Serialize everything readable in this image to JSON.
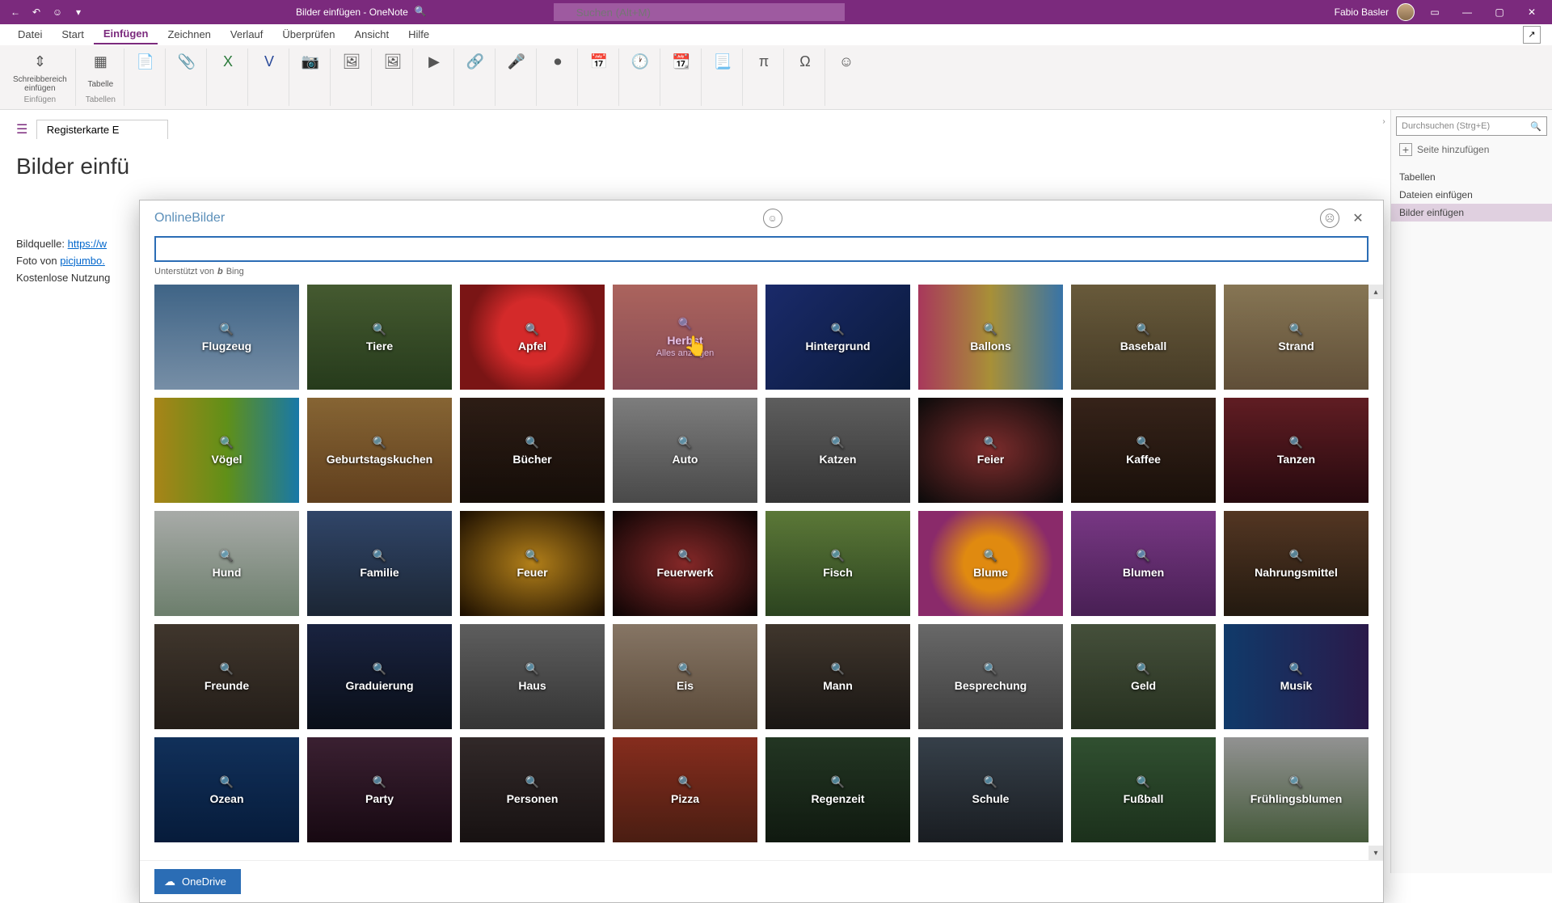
{
  "title_bar": {
    "app_title": "Bilder einfügen  -  OneNote",
    "search_placeholder": "Suchen (Alt+M)",
    "user_name": "Fabio Basler"
  },
  "ribbon_tabs": [
    "Datei",
    "Start",
    "Einfügen",
    "Zeichnen",
    "Verlauf",
    "Überprüfen",
    "Ansicht",
    "Hilfe"
  ],
  "ribbon_active": 2,
  "ribbon_groups": [
    {
      "label": "Schreibbereich\neinfügen",
      "sublabel": "Einfügen"
    },
    {
      "label": "Tabelle",
      "sublabel": "Tabellen"
    }
  ],
  "page": {
    "tab": "Registerkarte E",
    "title": "Bilder einfü",
    "src_label": "Bildquelle:",
    "src_link": "https://w",
    "photo_label": "Foto von",
    "photo_link": "picjumbo.",
    "license": "Kostenlose Nutzung"
  },
  "side": {
    "search_placeholder": "Durchsuchen (Strg+E)",
    "add_page": "Seite hinzufügen",
    "items": [
      "Tabellen",
      "Dateien einfügen",
      "Bilder einfügen"
    ],
    "active": 2
  },
  "dialog": {
    "title": "OnlineBilder",
    "powered_by": "Unterstützt von",
    "bing": "Bing",
    "onedrive": "OneDrive",
    "hover_sub": "Alles anzeigen",
    "categories": [
      {
        "label": "Flugzeug",
        "bg": "bg-plane"
      },
      {
        "label": "Tiere",
        "bg": "bg-animals"
      },
      {
        "label": "Apfel",
        "bg": "bg-apple"
      },
      {
        "label": "Herbst",
        "bg": "bg-autumn",
        "hovered": true
      },
      {
        "label": "Hintergrund",
        "bg": "bg-bg"
      },
      {
        "label": "Ballons",
        "bg": "bg-balloons"
      },
      {
        "label": "Baseball",
        "bg": "bg-baseball"
      },
      {
        "label": "Strand",
        "bg": "bg-beach"
      },
      {
        "label": "Vögel",
        "bg": "bg-birds"
      },
      {
        "label": "Geburtstagskuchen",
        "bg": "bg-cake"
      },
      {
        "label": "Bücher",
        "bg": "bg-books"
      },
      {
        "label": "Auto",
        "bg": "bg-car"
      },
      {
        "label": "Katzen",
        "bg": "bg-cats"
      },
      {
        "label": "Feier",
        "bg": "bg-celeb"
      },
      {
        "label": "Kaffee",
        "bg": "bg-coffee"
      },
      {
        "label": "Tanzen",
        "bg": "bg-dance"
      },
      {
        "label": "Hund",
        "bg": "bg-dog"
      },
      {
        "label": "Familie",
        "bg": "bg-family"
      },
      {
        "label": "Feuer",
        "bg": "bg-fire"
      },
      {
        "label": "Feuerwerk",
        "bg": "bg-fireworks"
      },
      {
        "label": "Fisch",
        "bg": "bg-fish"
      },
      {
        "label": "Blume",
        "bg": "bg-flower"
      },
      {
        "label": "Blumen",
        "bg": "bg-flowers"
      },
      {
        "label": "Nahrungsmittel",
        "bg": "bg-food"
      },
      {
        "label": "Freunde",
        "bg": "bg-friends"
      },
      {
        "label": "Graduierung",
        "bg": "bg-grad"
      },
      {
        "label": "Haus",
        "bg": "bg-house"
      },
      {
        "label": "Eis",
        "bg": "bg-ice"
      },
      {
        "label": "Mann",
        "bg": "bg-man"
      },
      {
        "label": "Besprechung",
        "bg": "bg-meeting"
      },
      {
        "label": "Geld",
        "bg": "bg-money"
      },
      {
        "label": "Musik",
        "bg": "bg-music"
      },
      {
        "label": "Ozean",
        "bg": "bg-ocean"
      },
      {
        "label": "Party",
        "bg": "bg-party"
      },
      {
        "label": "Personen",
        "bg": "bg-people"
      },
      {
        "label": "Pizza",
        "bg": "bg-pizza"
      },
      {
        "label": "Regenzeit",
        "bg": "bg-rain"
      },
      {
        "label": "Schule",
        "bg": "bg-school"
      },
      {
        "label": "Fußball",
        "bg": "bg-soccer"
      },
      {
        "label": "Frühlingsblumen",
        "bg": "bg-spring"
      }
    ]
  }
}
